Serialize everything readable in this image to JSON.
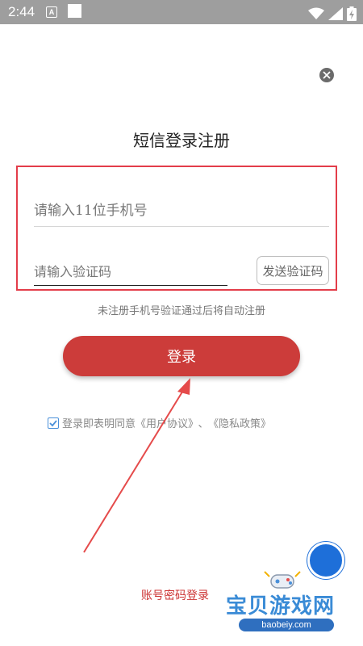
{
  "status_bar": {
    "time": "2:44",
    "notification_letter": "A"
  },
  "page": {
    "title": "短信登录注册",
    "hint": "未注册手机号验证通过后将自动注册"
  },
  "form": {
    "phone_placeholder": "请输入11位手机号",
    "code_placeholder": "请输入验证码",
    "send_code_label": "发送验证码"
  },
  "login_button": {
    "label": "登录"
  },
  "agreement": {
    "checked": true,
    "prefix": "登录即表明同意",
    "user_agreement": "《用户协议》",
    "separator": "、",
    "privacy_policy": "《隐私政策》"
  },
  "account_login": {
    "label": "账号密码登录"
  },
  "watermark": {
    "title": "宝贝游戏网",
    "url": "baobeiy.com"
  },
  "colors": {
    "accent_red": "#cc3c3a",
    "highlight_border": "#e33d4a",
    "checkbox_blue": "#4a90d9",
    "float_button_blue": "#1e6fd9"
  },
  "icons": [
    "close-icon",
    "check-icon",
    "wifi-icon",
    "signal-icon",
    "battery-icon",
    "gamepad-icon"
  ]
}
